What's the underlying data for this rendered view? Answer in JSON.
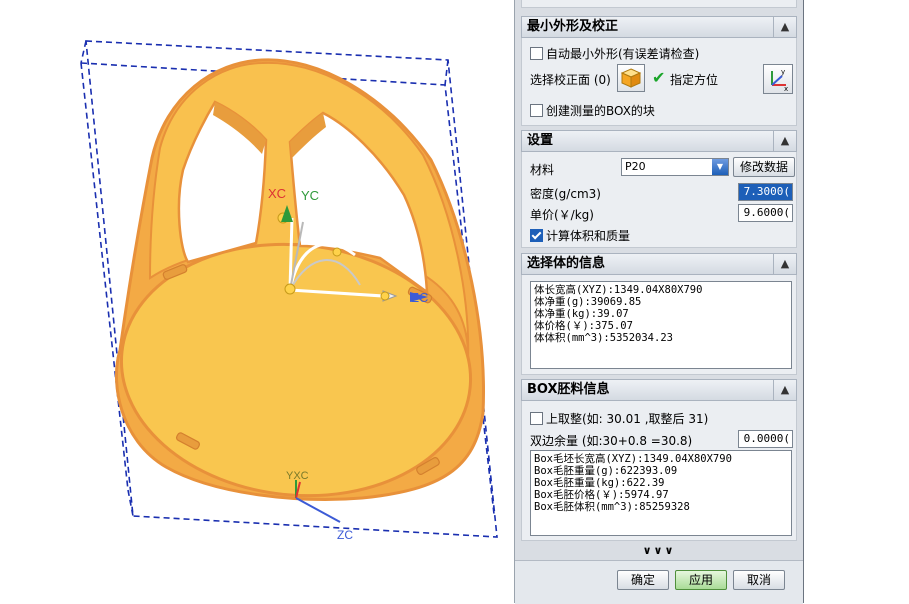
{
  "section_min_shape": {
    "title": "最小外形及校正",
    "auto_min_label": "自动最小外形(有误差请检查)",
    "select_face_label": "选择校正面 (0)",
    "specify_orientation_label": "指定方位",
    "create_box_block_label": "创建测量的BOX的块"
  },
  "section_settings": {
    "title": "设置",
    "material_label": "材料",
    "material_value": "P20",
    "modify_data_label": "修改数据",
    "density_label": "密度(g/cm3)",
    "density_value": "7.3000(",
    "unit_price_label": "单价(￥/kg)",
    "unit_price_value": "9.6000(",
    "calc_volume_mass_label": "计算体积和质量"
  },
  "section_selected_info": {
    "title": "选择体的信息",
    "lines": [
      "体长宽高(XYZ):1349.04X80X790",
      "体净重(g):39069.85",
      "体净重(kg):39.07",
      "体价格(￥):375.07",
      "体体积(mm^3):5352034.23"
    ]
  },
  "section_box_blank": {
    "title": "BOX胚料信息",
    "round_up_label": "上取整(如: 30.01 ,取整后 31)",
    "double_allowance_label": "双边余量 (如:30+0.8 =30.8)",
    "double_allowance_value": "0.0000(",
    "lines": [
      "Box毛坯长宽高(XYZ):1349.04X80X790",
      "Box毛胚重量(g):622393.09",
      "Box毛胚重量(kg):622.39",
      "Box毛胚价格(￥):5974.97",
      "Box毛胚体积(mm^3):85259328"
    ]
  },
  "more_chevrons": "∨∨∨",
  "footer": {
    "ok_label": "确定",
    "apply_label": "应用",
    "cancel_label": "取消"
  },
  "viewport": {
    "axis_labels": {
      "xc_top": "XC",
      "yc_top": "YC",
      "zc_top": "ZC",
      "yxc_bottom": "YXC",
      "zc_bottom": "ZC"
    }
  },
  "icons": {
    "collapse": "chevron-up-icon",
    "face_select": "cube-select-icon",
    "orientation": "csys-orientation-icon",
    "dropdown": "dropdown-arrow-icon",
    "check": "green-check-icon"
  },
  "colors": {
    "part_fill": "#f9c14e",
    "part_edge": "#e8913a",
    "bounding_box": "#1a2fb0",
    "highlight_box": "#e8202a",
    "apply_button": "#bfe8b0"
  }
}
